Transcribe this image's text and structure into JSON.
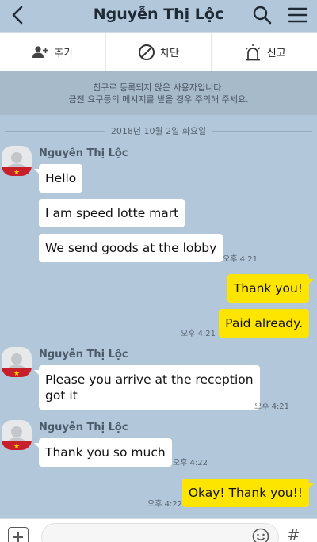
{
  "header": {
    "title": "Nguyễn Thị Lộc"
  },
  "actions": {
    "add_label": "추가",
    "block_label": "차단",
    "report_label": "신고"
  },
  "notice": {
    "line1": "친구로 등록되지 않은 사용자입니다.",
    "line2": "금전 요구등의 메시지를 받을 경우 주의해 주세요."
  },
  "date_divider": "2018년 10월 2일 화요일",
  "messages": [
    {
      "direction": "in",
      "sender": "Nguyễn Thị Lộc",
      "text": "Hello"
    },
    {
      "direction": "in",
      "text": "I am speed lotte mart"
    },
    {
      "direction": "in",
      "text": "We send goods at the lobby",
      "time": "오후 4:21"
    },
    {
      "direction": "out",
      "text": "Thank you!"
    },
    {
      "direction": "out",
      "text": "Paid already.",
      "time": "오후 4:21"
    },
    {
      "direction": "in",
      "sender": "Nguyễn Thị Lộc",
      "text_line1": "Please you arrive at the reception",
      "text_line2": "got it",
      "time": "오후 4:21"
    },
    {
      "direction": "in",
      "sender": "Nguyễn Thị Lộc",
      "text": "Thank you so much",
      "time": "오후 4:22"
    },
    {
      "direction": "out",
      "text": "Okay! Thank you!!",
      "time": "오후 4:22"
    }
  ],
  "input_bar": {
    "hash_label": "#"
  },
  "colors": {
    "chat_background": "#b2c7da",
    "incoming_bubble": "#ffffff",
    "outgoing_bubble": "#fee500",
    "notice_background": "#a7bac9"
  }
}
